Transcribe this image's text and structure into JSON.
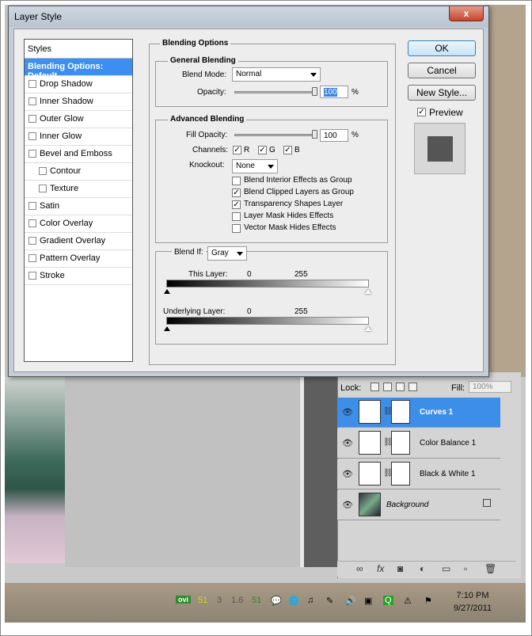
{
  "window": {
    "title": "Layer Style",
    "close_label": "x"
  },
  "styles_panel": {
    "header": "Styles",
    "items": [
      {
        "label": "Blending Options: Default",
        "active": true,
        "checkbox": false,
        "sub": false
      },
      {
        "label": "Drop Shadow",
        "active": false,
        "checkbox": true,
        "sub": false
      },
      {
        "label": "Inner Shadow",
        "active": false,
        "checkbox": true,
        "sub": false
      },
      {
        "label": "Outer Glow",
        "active": false,
        "checkbox": true,
        "sub": false
      },
      {
        "label": "Inner Glow",
        "active": false,
        "checkbox": true,
        "sub": false
      },
      {
        "label": "Bevel and Emboss",
        "active": false,
        "checkbox": true,
        "sub": false
      },
      {
        "label": "Contour",
        "active": false,
        "checkbox": true,
        "sub": true
      },
      {
        "label": "Texture",
        "active": false,
        "checkbox": true,
        "sub": true
      },
      {
        "label": "Satin",
        "active": false,
        "checkbox": true,
        "sub": false
      },
      {
        "label": "Color Overlay",
        "active": false,
        "checkbox": true,
        "sub": false
      },
      {
        "label": "Gradient Overlay",
        "active": false,
        "checkbox": true,
        "sub": false
      },
      {
        "label": "Pattern Overlay",
        "active": false,
        "checkbox": true,
        "sub": false
      },
      {
        "label": "Stroke",
        "active": false,
        "checkbox": true,
        "sub": false
      }
    ]
  },
  "blending": {
    "title": "Blending Options",
    "general": {
      "title": "General Blending",
      "mode_label": "Blend Mode:",
      "mode_value": "Normal",
      "opacity_label": "Opacity:",
      "opacity_value": "100",
      "opacity_unit": "%",
      "opacity_fraction": 1.0
    },
    "advanced": {
      "title": "Advanced Blending",
      "fill_label": "Fill Opacity:",
      "fill_value": "100",
      "fill_unit": "%",
      "fill_fraction": 1.0,
      "channels_label": "Channels:",
      "channels": [
        {
          "label": "R",
          "checked": true
        },
        {
          "label": "G",
          "checked": true
        },
        {
          "label": "B",
          "checked": true
        }
      ],
      "knockout_label": "Knockout:",
      "knockout_value": "None",
      "options": [
        {
          "label": "Blend Interior Effects as Group",
          "checked": false
        },
        {
          "label": "Blend Clipped Layers as Group",
          "checked": true
        },
        {
          "label": "Transparency Shapes Layer",
          "checked": true
        },
        {
          "label": "Layer Mask Hides Effects",
          "checked": false
        },
        {
          "label": "Vector Mask Hides Effects",
          "checked": false
        }
      ]
    },
    "blend_if": {
      "label": "Blend If:",
      "value": "Gray",
      "this_layer_label": "This Layer:",
      "this_low": "0",
      "this_high": "255",
      "underlying_label": "Underlying Layer:",
      "under_low": "0",
      "under_high": "255"
    }
  },
  "buttons": {
    "ok": "OK",
    "cancel": "Cancel",
    "new_style": "New Style...",
    "preview": "Preview",
    "preview_checked": true
  },
  "layers_panel": {
    "lock_label": "Lock:",
    "fill_label": "Fill:",
    "fill_value": "100%",
    "layers": [
      {
        "name": "Curves 1",
        "selected": true,
        "locked": false
      },
      {
        "name": "Color Balance 1",
        "selected": false,
        "locked": false
      },
      {
        "name": "Black & White 1",
        "selected": false,
        "locked": false
      },
      {
        "name": "Background",
        "selected": false,
        "locked": true
      }
    ],
    "bottom_icons": [
      "link-icon",
      "fx-icon",
      "mask-icon",
      "adjustment-icon",
      "folder-icon",
      "new-layer-icon",
      "trash-icon"
    ]
  },
  "taskbar": {
    "tray": [
      "ovi",
      "51",
      "3",
      "1.6",
      "51"
    ],
    "time": "7:10 PM",
    "date": "9/27/2011"
  }
}
